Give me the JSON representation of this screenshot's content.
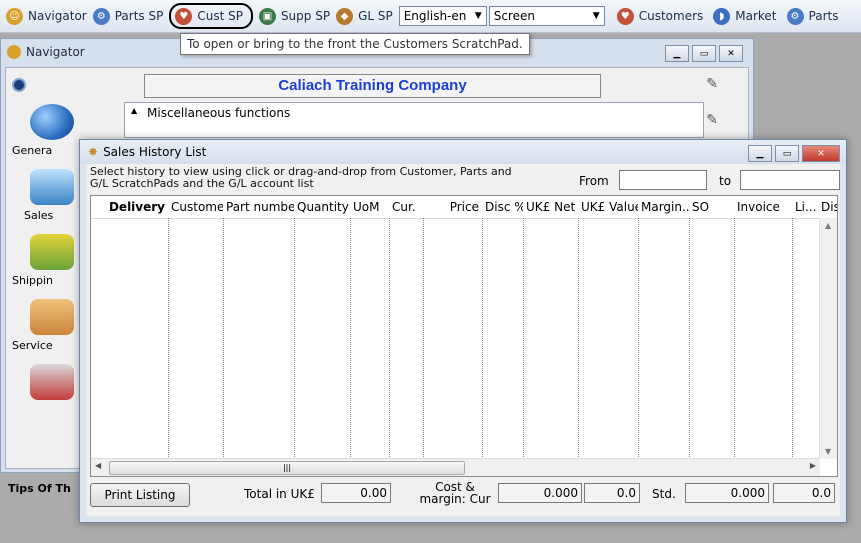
{
  "toolbar": {
    "items": [
      {
        "label": "Navigator",
        "icon": "navigator-icon",
        "color": "#d9a12b"
      },
      {
        "label": "Parts SP",
        "icon": "parts-sp-icon",
        "color": "#4a7bc4"
      },
      {
        "label": "Cust SP",
        "icon": "cust-sp-icon",
        "color": "#c4503a"
      },
      {
        "label": "Supp SP",
        "icon": "supp-sp-icon",
        "color": "#3d7a4a"
      },
      {
        "label": "GL SP",
        "icon": "gl-sp-icon",
        "color": "#b77a2c"
      }
    ],
    "language": "English-en",
    "output": "Screen",
    "right_items": [
      {
        "label": "Customers",
        "icon": "customers-icon",
        "color": "#c4503a"
      },
      {
        "label": "Market",
        "icon": "market-icon",
        "color": "#3a6fc4"
      },
      {
        "label": "Parts",
        "icon": "parts-icon",
        "color": "#4a7bc4"
      }
    ]
  },
  "tooltip": "To open or bring to the front the Customers ScratchPad.",
  "navigator": {
    "title": "Navigator",
    "company": "Caliach Training Company",
    "misc": "Miscellaneous functions",
    "icons": [
      {
        "label": "Genera",
        "icon": "globe-icon",
        "color": "#2d6ec0"
      },
      {
        "label": "Sales",
        "icon": "sales-icon",
        "color": "#3b82c4"
      },
      {
        "label": "Shippin",
        "icon": "shipping-cart-icon",
        "color": "#6aa33a"
      },
      {
        "label": "Service",
        "icon": "handshake-icon",
        "color": "#c9853a"
      },
      {
        "label": "",
        "icon": "tools-icon",
        "color": "#c23b3b"
      }
    ],
    "tips": "Tips Of Th"
  },
  "sales": {
    "title": "Sales History List",
    "instructions": "Select history to view using click or drag-and-drop from Customer, Parts and G/L ScratchPads and the G/L account list",
    "from_label": "From",
    "to_label": "to",
    "columns": [
      "Delivery",
      "Customer",
      "Part number",
      "Quantity",
      "UoM",
      "Cur.",
      "Price",
      "Disc %",
      "UK£ Net",
      "UK£ Value",
      "Margin...",
      "SO",
      "Invoice",
      "Li...",
      "Disp"
    ],
    "print_label": "Print Listing",
    "total_label": "Total in UK£",
    "total_value": "0.00",
    "cost_label": "Cost & margin: Cur",
    "cost_value": "0.000",
    "margin_value": "0.0",
    "std_label": "Std.",
    "std_value": "0.000",
    "std_margin": "0.0"
  }
}
